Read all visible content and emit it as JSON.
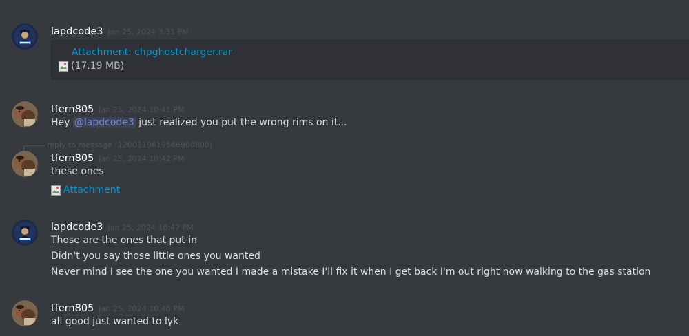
{
  "messages": [
    {
      "author": "lapdcode3",
      "timestamp": "Jan 25, 2024 3:31 PM",
      "attachment": {
        "label": "Attachment: chpghostcharger.rar",
        "size": "(17.19 MB)"
      }
    },
    {
      "author": "tfern805",
      "timestamp": "Jan 25, 2024 10:41 PM",
      "text_before": "Hey ",
      "mention": "@lapdcode3",
      "text_after": " just realized you put the wrong rims on it..."
    },
    {
      "reply": "reply to message (1200119619566960800)",
      "author": "tfern805",
      "timestamp": "Jan 25, 2024 10:42 PM",
      "text": "these ones",
      "image_attachment": "Attachment"
    },
    {
      "author": "lapdcode3",
      "timestamp": "Jan 25, 2024 10:47 PM",
      "lines": [
        "Those are the ones that put in",
        "Didn't you say those little ones you wanted",
        "Never mind I see the one you wanted I made a mistake I'll fix it when I get back I'm out right now walking to the gas station"
      ]
    },
    {
      "author": "tfern805",
      "timestamp": "Jan 25, 2024 10:48 PM",
      "text": "all good just wanted to lyk"
    }
  ],
  "icons": {
    "broken_image": "broken-image-icon",
    "avatar_lapd": "police-badge-avatar",
    "avatar_tfern": "photo-avatar"
  }
}
